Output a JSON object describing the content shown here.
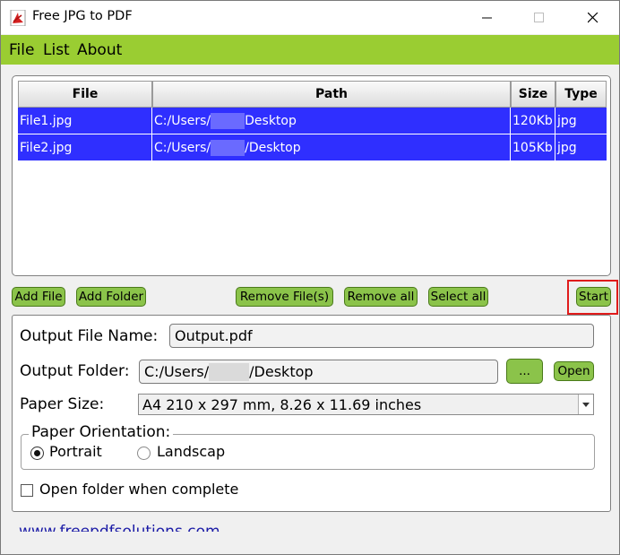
{
  "window": {
    "title": "Free JPG to PDF"
  },
  "menu": [
    "File",
    "List",
    "About"
  ],
  "file_table": {
    "columns": [
      "File",
      "Path",
      "Size",
      "Type"
    ],
    "rows": [
      {
        "file": "File1.jpg",
        "path_prefix": "C:/Users/",
        "path_suffix": "Desktop",
        "size": "120Kb",
        "type": "jpg"
      },
      {
        "file": "File2.jpg",
        "path_prefix": "C:/Users/",
        "path_suffix": "/Desktop",
        "size": "105Kb",
        "type": "jpg"
      }
    ]
  },
  "buttons": {
    "add_file": "Add File",
    "add_folder": "Add Folder",
    "remove_files": "Remove File(s)",
    "remove_all": "Remove all",
    "select_all": "Select all",
    "start": "Start",
    "browse": "...",
    "open": "Open"
  },
  "settings": {
    "output_file_name_label": "Output File Name:",
    "output_file_name_value": "Output.pdf",
    "output_folder_label": "Output Folder:",
    "output_folder_prefix": "C:/Users/",
    "output_folder_suffix": "/Desktop",
    "paper_size_label": "Paper Size:",
    "paper_size_value": "A4 210 x 297 mm, 8.26 x 11.69 inches",
    "orientation_label": "Paper Orientation:",
    "orientation_options": [
      "Portrait",
      "Landscap"
    ],
    "orientation_selected": "Portrait",
    "open_folder_label": "Open folder when complete",
    "open_folder_checked": false
  },
  "footer_link": "www.freepdfsolutions.com",
  "colors": {
    "menubar": "#9acd32",
    "selection": "#2f2fff",
    "button": "#8bc34a",
    "highlight": "#e01b1b"
  }
}
